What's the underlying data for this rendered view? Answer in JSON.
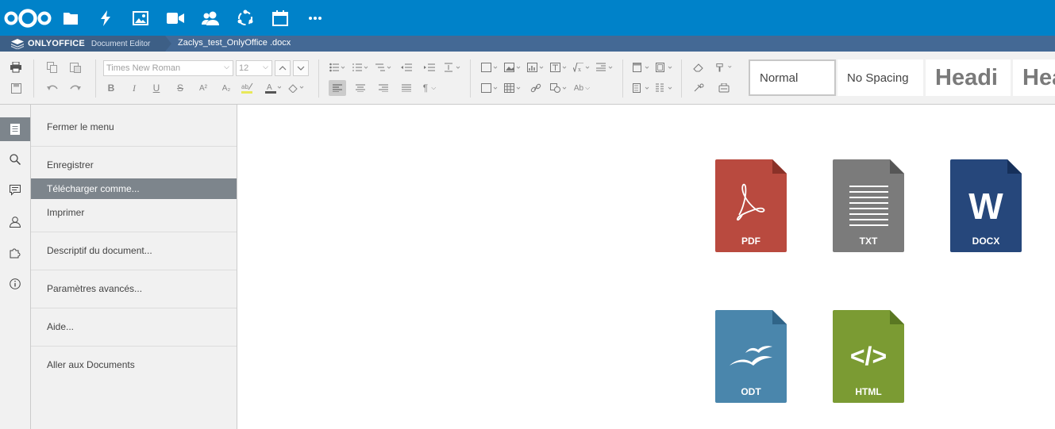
{
  "nextcloud": {
    "apps": [
      "files-icon",
      "activity-icon",
      "gallery-icon",
      "talk-icon",
      "contacts-icon",
      "circles-icon",
      "calendar-icon",
      "more-icon"
    ]
  },
  "header": {
    "brand": "ONLYOFFICE",
    "editor": "Document Editor",
    "filename": "Zaclys_test_OnlyOffice .docx"
  },
  "toolbar": {
    "font_name": "Times New Roman",
    "font_size": "12",
    "styles": [
      "Normal",
      "No Spacing",
      "Headi",
      "Hea"
    ]
  },
  "file_menu": {
    "items": [
      {
        "label": "Fermer le menu"
      },
      {
        "label": "Enregistrer"
      },
      {
        "label": "Télécharger comme..."
      },
      {
        "label": "Imprimer"
      },
      {
        "label": "Descriptif du document..."
      },
      {
        "label": "Paramètres avancés..."
      },
      {
        "label": "Aide..."
      },
      {
        "label": "Aller aux Documents"
      }
    ]
  },
  "download_formats": [
    {
      "label": "PDF",
      "color": "#b94a3f",
      "fold": "#8a3128"
    },
    {
      "label": "TXT",
      "color": "#7b7b7b",
      "fold": "#565656"
    },
    {
      "label": "DOCX",
      "color": "#26477b",
      "fold": "#16305a",
      "glyph": "W"
    },
    {
      "label": "ODT",
      "color": "#4a86ac",
      "fold": "#2f6488"
    },
    {
      "label": "HTML",
      "color": "#7b9b33",
      "fold": "#5a7722",
      "glyph": "</>"
    }
  ],
  "colors": {
    "nextcloud_blue": "#0082c9",
    "oo_header": "#446995",
    "toolbar_bg": "#f1f1f1",
    "menu_selected": "#7d858c"
  }
}
